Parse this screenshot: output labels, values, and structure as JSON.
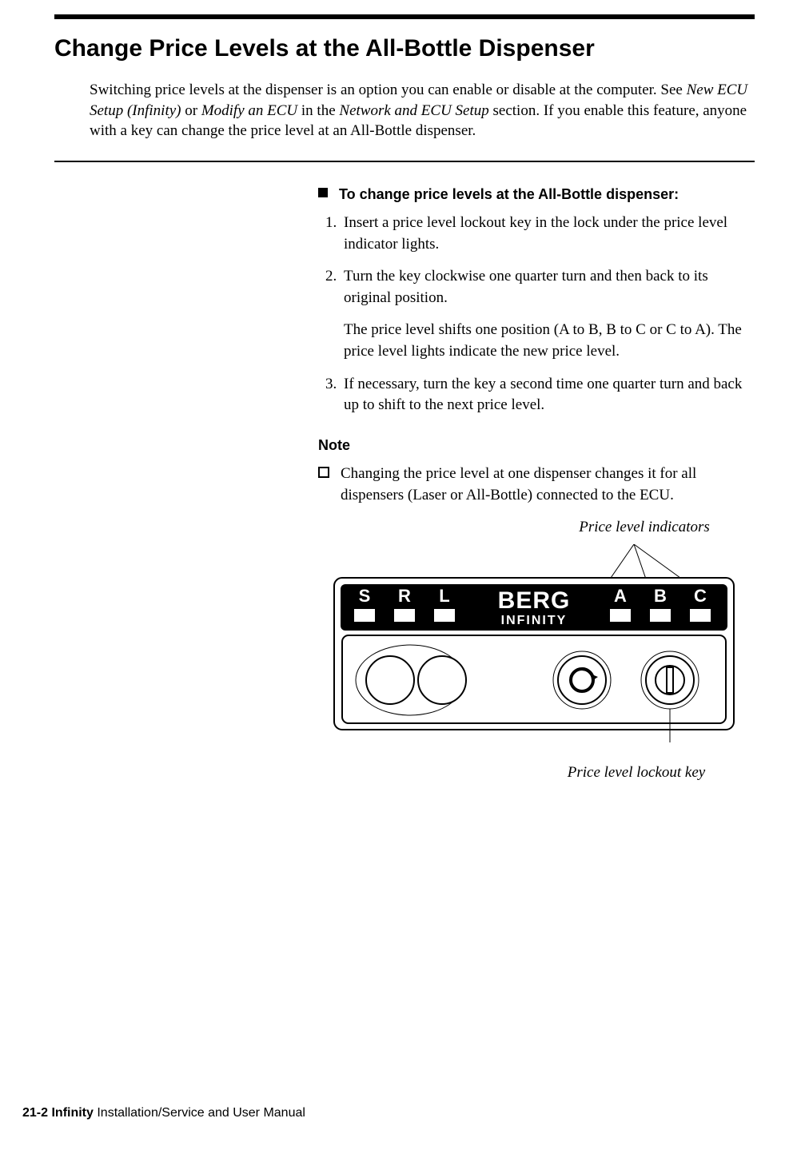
{
  "heading": "Change Price Levels at the All-Bottle Dispenser",
  "intro": {
    "p1a": "Switching price levels at the dispenser is an option you can enable or disable at the computer. See ",
    "ital1": "New ECU Setup (Infinity)",
    "p1b": " or ",
    "ital2": "Modify an ECU",
    "p1c": " in the ",
    "ital3": "Network and ECU Setup",
    "p1d": " section. If you enable this feature, anyone with a key can change the price level at an All-Bottle dispenser."
  },
  "task_heading": "To change price levels at the All-Bottle dispenser:",
  "steps": [
    {
      "text": "Insert a price level lockout key in the lock under the price level indicator lights."
    },
    {
      "text": "Turn the key clockwise one quarter turn and then back to its original position.",
      "extra": "The price level shifts one position (A to B, B to C or C to A). The price level lights indicate the new price level."
    },
    {
      "text": "If necessary, turn the key a second time one quarter turn and back up to shift to the next price level."
    }
  ],
  "note_heading": "Note",
  "notes": [
    "Changing the price level at one dispenser changes it for all dispensers (Laser or All-Bottle) connected to the ECU."
  ],
  "diagram": {
    "top_callout": "Price level indicators",
    "bottom_callout": "Price level lockout key",
    "left_labels": [
      "S",
      "R",
      "L"
    ],
    "right_labels": [
      "A",
      "B",
      "C"
    ],
    "brand": "BERG",
    "model": "INFINITY"
  },
  "footer": {
    "page": "21-2 Infinity",
    "rest": " Installation/Service and User Manual"
  }
}
